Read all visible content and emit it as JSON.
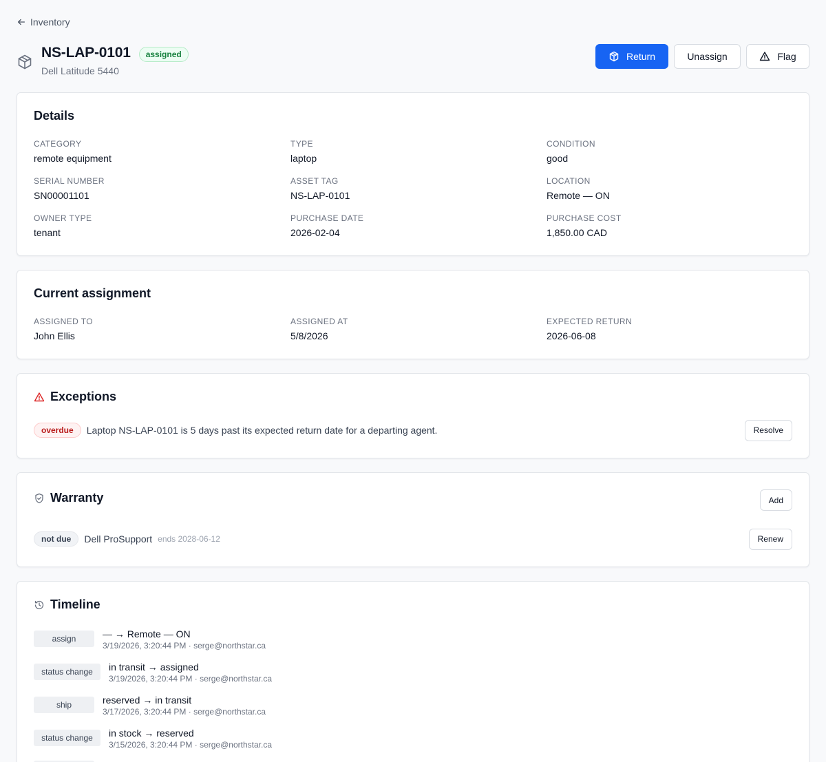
{
  "nav": {
    "back_label": "Inventory"
  },
  "header": {
    "title": "NS-LAP-0101",
    "status": "assigned",
    "subtitle": "Dell Latitude 5440",
    "actions": {
      "return": "Return",
      "unassign": "Unassign",
      "flag": "Flag"
    }
  },
  "details": {
    "title": "Details",
    "fields": [
      {
        "label": "CATEGORY",
        "value": "remote equipment"
      },
      {
        "label": "TYPE",
        "value": "laptop"
      },
      {
        "label": "CONDITION",
        "value": "good"
      },
      {
        "label": "SERIAL NUMBER",
        "value": "SN00001101"
      },
      {
        "label": "ASSET TAG",
        "value": "NS-LAP-0101"
      },
      {
        "label": "LOCATION",
        "value": "Remote — ON"
      },
      {
        "label": "OWNER TYPE",
        "value": "tenant"
      },
      {
        "label": "PURCHASE DATE",
        "value": "2026-02-04"
      },
      {
        "label": "PURCHASE COST",
        "value": "1,850.00 CAD"
      }
    ]
  },
  "assignment": {
    "title": "Current assignment",
    "fields": [
      {
        "label": "ASSIGNED TO",
        "value": "John Ellis"
      },
      {
        "label": "ASSIGNED AT",
        "value": "5/8/2026"
      },
      {
        "label": "EXPECTED RETURN",
        "value": "2026-06-08"
      }
    ]
  },
  "exceptions": {
    "title": "Exceptions",
    "items": [
      {
        "badge": "overdue",
        "text": "Laptop NS-LAP-0101 is 5 days past its expected return date for a departing agent.",
        "action": "Resolve"
      }
    ]
  },
  "warranty": {
    "title": "Warranty",
    "add_label": "Add",
    "items": [
      {
        "badge": "not due",
        "provider": "Dell ProSupport",
        "ends": "ends 2028-06-12",
        "action": "Renew"
      }
    ]
  },
  "timeline": {
    "title": "Timeline",
    "items": [
      {
        "tag": "assign",
        "change": "— → Remote — ON",
        "meta": "3/19/2026, 3:20:44 PM · serge@northstar.ca"
      },
      {
        "tag": "status change",
        "change": "in transit → assigned",
        "meta": "3/19/2026, 3:20:44 PM · serge@northstar.ca"
      },
      {
        "tag": "ship",
        "change": "reserved → in transit",
        "meta": "3/17/2026, 3:20:44 PM · serge@northstar.ca"
      },
      {
        "tag": "status change",
        "change": "in stock → reserved",
        "meta": "3/15/2026, 3:20:44 PM · serge@northstar.ca"
      }
    ]
  },
  "colors": {
    "primary": "#1764f3",
    "success": "#15803d",
    "danger": "#dc2626"
  }
}
